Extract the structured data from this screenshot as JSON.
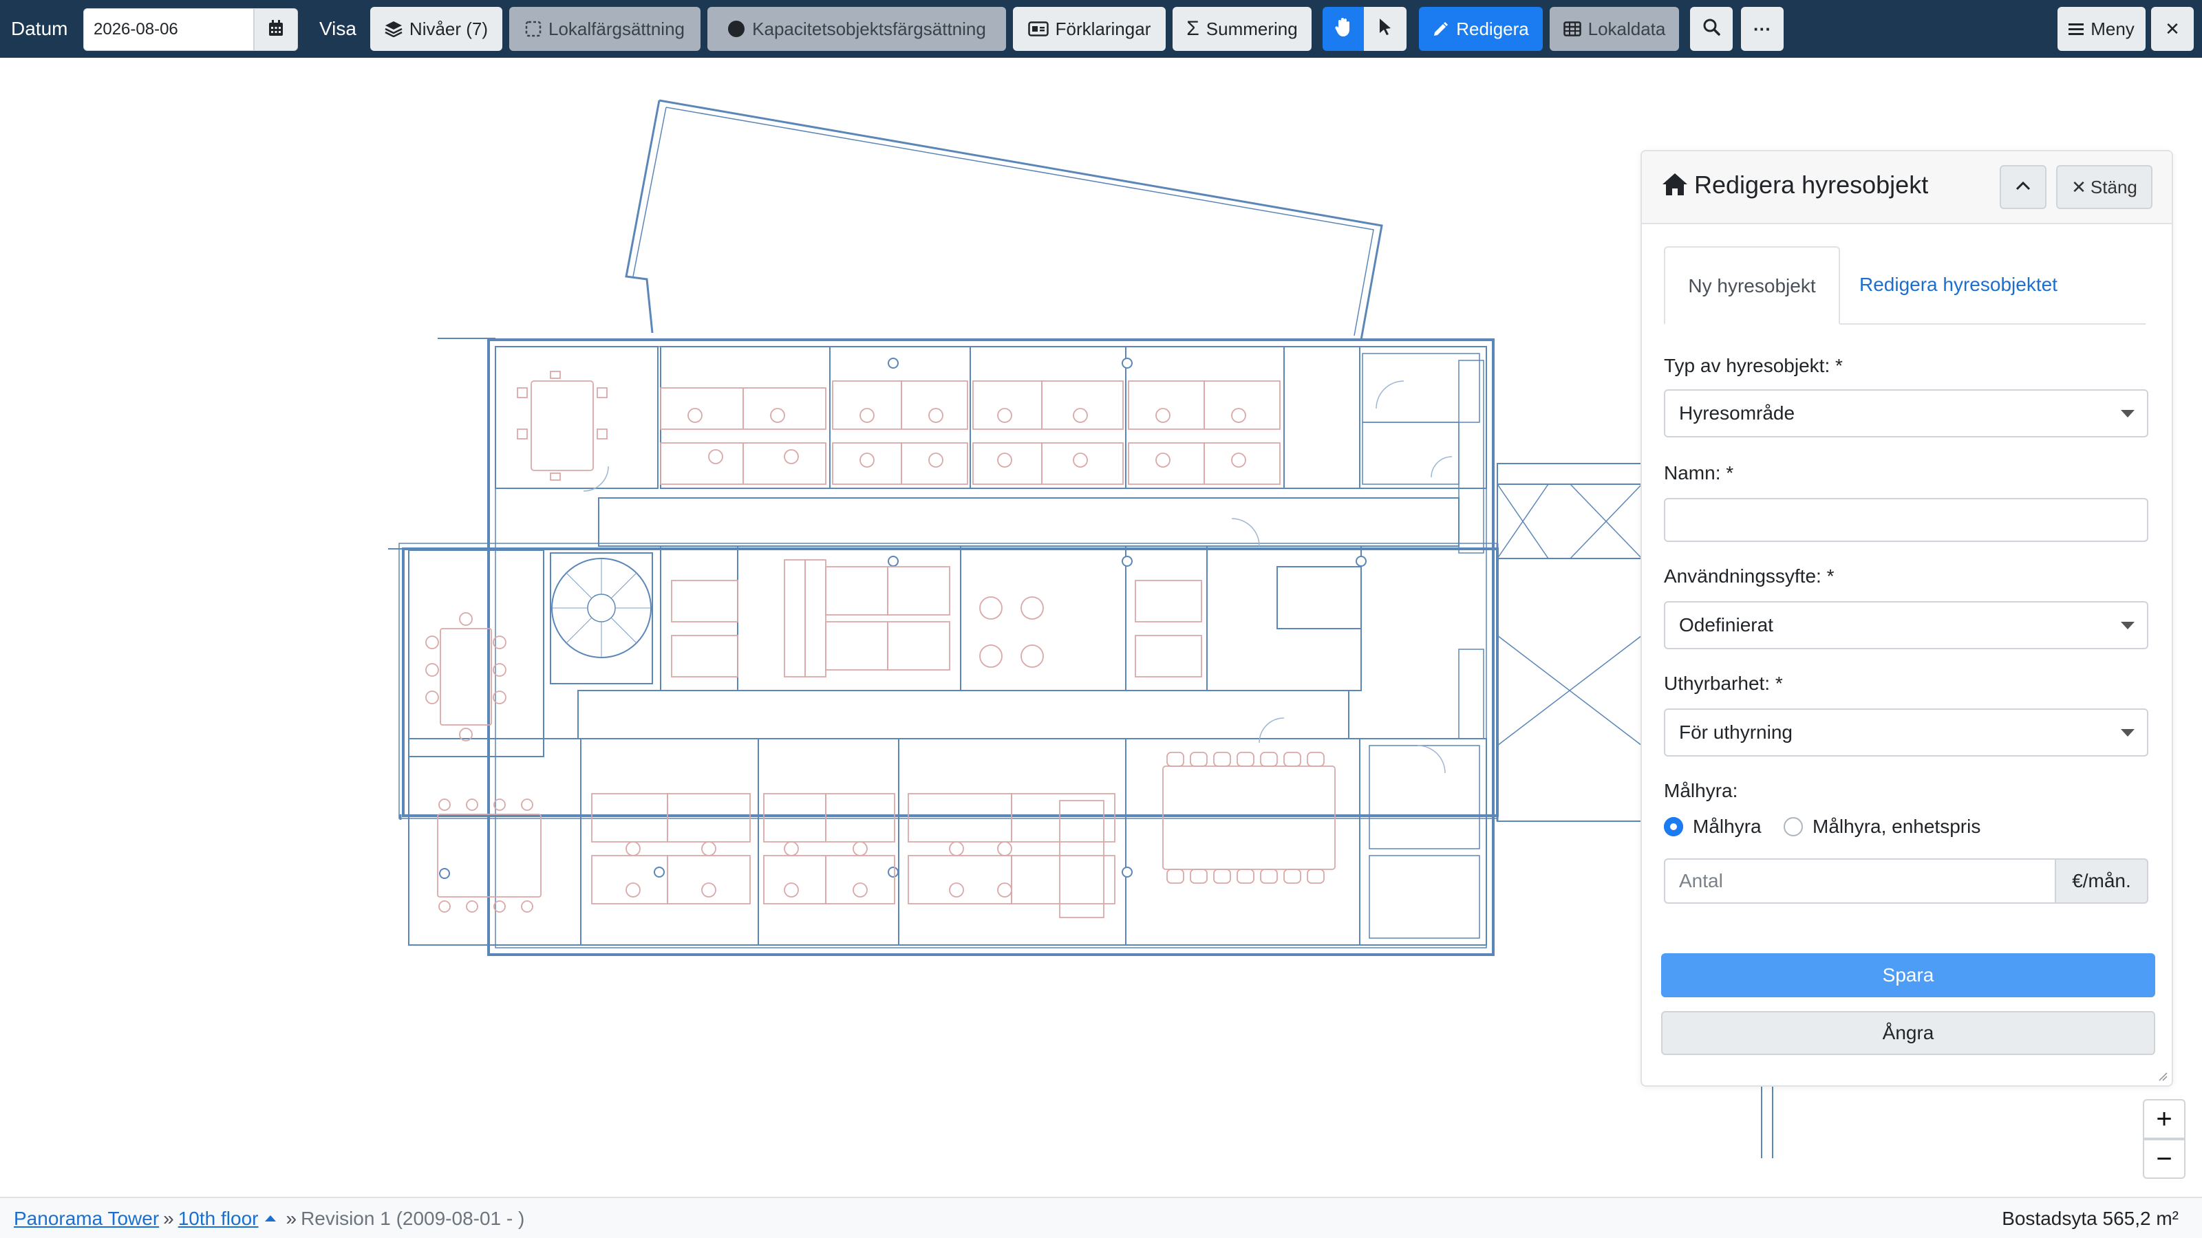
{
  "toolbar": {
    "date_label": "Datum",
    "date_value": "2026-08-06",
    "show_label": "Visa",
    "levels_label": "Nivåer (7)",
    "room_coloring_label": "Lokalfärgsättning",
    "capacity_coloring_label": "Kapacitetsobjektsfärgsättning",
    "legends_label": "Förklaringar",
    "summary_label": "Summering",
    "edit_label": "Redigera",
    "room_data_label": "Lokaldata",
    "more_label": "···",
    "menu_label": "Meny",
    "close_label": "✕"
  },
  "panel": {
    "title": "Redigera hyresobjekt",
    "close_label": "Stäng",
    "tabs": [
      {
        "label": "Ny hyresobjekt",
        "active": true
      },
      {
        "label": "Redigera hyresobjektet",
        "active": false
      }
    ],
    "type_label": "Typ av hyresobjekt: *",
    "type_value": "Hyresområde",
    "name_label": "Namn: *",
    "name_value": "",
    "purpose_label": "Användningssyfte: *",
    "purpose_value": "Odefinierat",
    "rentability_label": "Uthyrbarhet: *",
    "rentability_value": "För uthyrning",
    "target_rent_label": "Målhyra:",
    "radio_target": "Målhyra",
    "radio_unit_price": "Målhyra, enhetspris",
    "amount_placeholder": "Antal",
    "amount_unit": "€/mån.",
    "save_label": "Spara",
    "undo_label": "Ångra"
  },
  "zoom": {
    "in": "+",
    "out": "−"
  },
  "statusbar": {
    "building": "Panorama Tower",
    "floor": "10th floor",
    "revision": "Revision 1 (2009-08-01 - )",
    "area": "Bostadsyta 565,2 m²"
  },
  "icons": {
    "calendar": "calendar-icon",
    "layers": "layers-icon",
    "hand": "hand-icon",
    "pointer": "pointer-icon",
    "pencil": "pencil-icon",
    "table": "table-icon",
    "search": "search-icon",
    "home": "home-icon",
    "chevron": "chevron-up-icon"
  },
  "colors": {
    "toolbar_bg": "#1c3853",
    "accent": "#1a7cf0",
    "wall": "#3d6fa8",
    "furniture": "#d7a0a0"
  }
}
